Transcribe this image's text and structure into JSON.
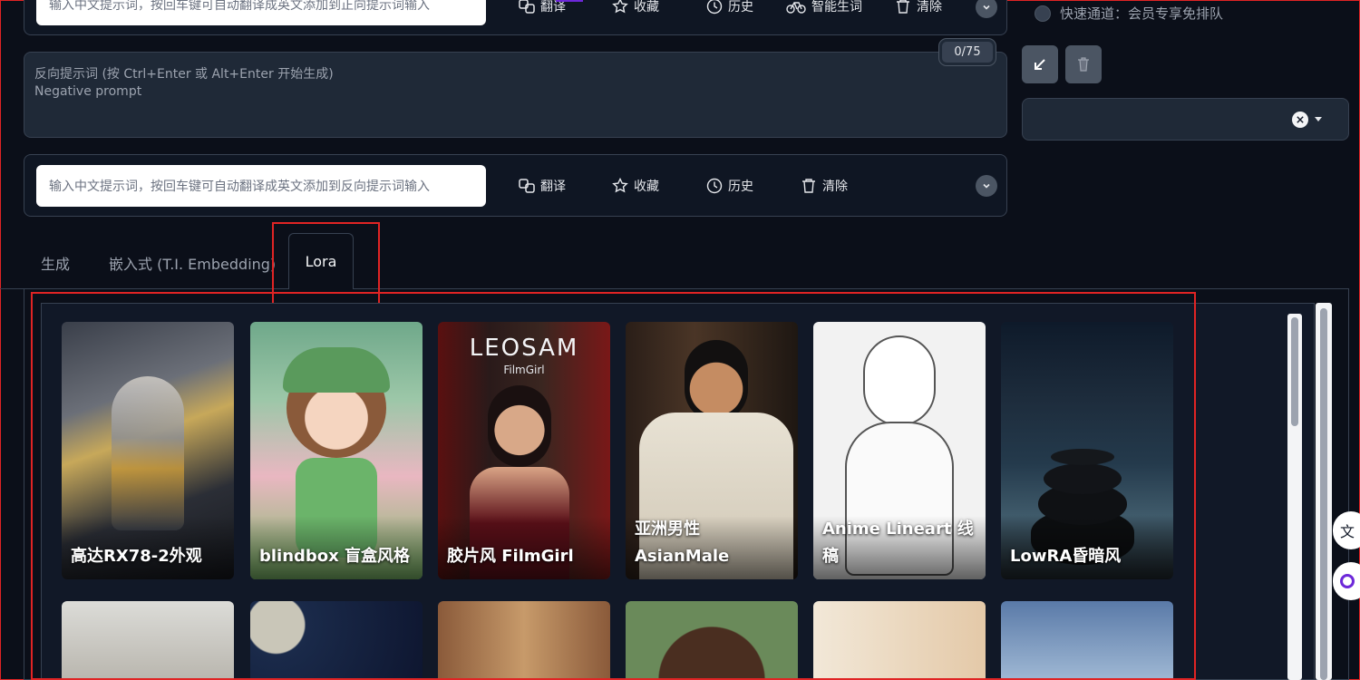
{
  "positive_toolbar": {
    "input_placeholder": "输入中文提示词，按回车键可自动翻译成英文添加到正向提示词输入",
    "translate": "翻译",
    "favorite": "收藏",
    "history": "历史",
    "smart_words": "智能生词",
    "clear": "清除"
  },
  "negative_prompt": {
    "placeholder_line1": "反向提示词 (按 Ctrl+Enter 或 Alt+Enter 开始生成)",
    "placeholder_line2": "Negative prompt",
    "counter": "0/75"
  },
  "negative_toolbar": {
    "input_placeholder": "输入中文提示词，按回车键可自动翻译成英文添加到反向提示词输入",
    "translate": "翻译",
    "favorite": "收藏",
    "history": "历史",
    "clear": "清除"
  },
  "right_panel": {
    "fast_lane_label": "快速通道：会员专享免排队"
  },
  "tabs": [
    {
      "label": "生成"
    },
    {
      "label": "嵌入式 (T.I. Embedding)"
    },
    {
      "label": "Lora"
    }
  ],
  "lora_cards_row1": [
    {
      "label": "高达RX78-2外观"
    },
    {
      "label": "blindbox 盲盒风格"
    },
    {
      "label": "胶片风 FilmGirl",
      "logo_text": "LEOSAM",
      "logo_sub": "FilmGirl"
    },
    {
      "label": "亚洲男性 AsianMale"
    },
    {
      "label": "Anime Lineart 线稿"
    },
    {
      "label": "LowRA昏暗风"
    }
  ],
  "side_icon": {
    "text": "文"
  },
  "colors": {
    "background": "#0b0f19",
    "panel": "#1f2937",
    "border": "#374151",
    "highlight": "#e02424",
    "accent": "#6d28d9"
  }
}
